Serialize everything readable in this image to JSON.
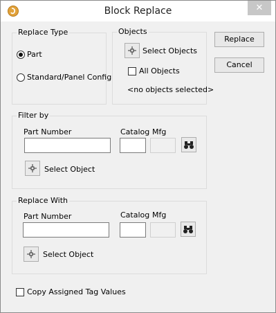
{
  "window": {
    "title": "Block Replace",
    "close_glyph": "✕"
  },
  "buttons": {
    "replace": "Replace",
    "cancel": "Cancel"
  },
  "replace_type": {
    "label": "Replace Type",
    "option_part": "Part",
    "option_standard": "Standard/Panel Config",
    "selected": "Part"
  },
  "objects": {
    "label": "Objects",
    "select_objects": "Select Objects",
    "all_objects": "All Objects",
    "all_objects_checked": false,
    "status": "<no objects selected>"
  },
  "filter_by": {
    "label": "Filter by",
    "part_number_label": "Part Number",
    "part_number_value": "",
    "catalog_label": "Catalog",
    "catalog_value": "",
    "mfg_label": "Mfg",
    "mfg_value": "",
    "select_object": "Select Object"
  },
  "replace_with": {
    "label": "Replace With",
    "part_number_label": "Part Number",
    "part_number_value": "",
    "catalog_label": "Catalog",
    "catalog_value": "",
    "mfg_label": "Mfg",
    "mfg_value": "",
    "select_object": "Select Object"
  },
  "copy_tag_values": {
    "label": "Copy Assigned Tag Values",
    "checked": false
  },
  "icons": {
    "pick": "crosshair-icon",
    "browse": "binoculars-icon",
    "app": "app-logo-icon"
  }
}
